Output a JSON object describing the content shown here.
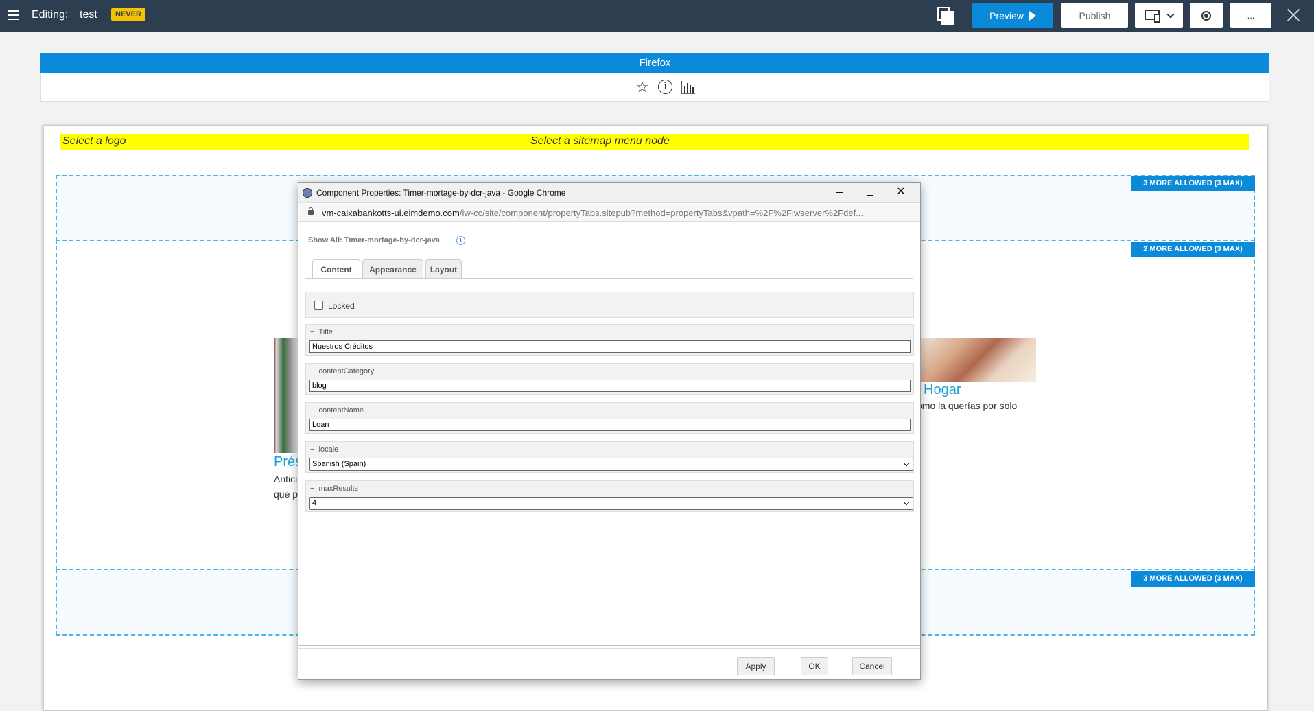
{
  "topbar": {
    "editing_label": "Editing:",
    "page_name": "test",
    "status_badge": "NEVER",
    "preview_label": "Preview",
    "publish_label": "Publish",
    "more_label": "...",
    "colors": {
      "bar": "#2c3e50",
      "accent": "#0a8ad8",
      "badge": "#f5c400"
    }
  },
  "browser": {
    "name": "Firefox",
    "icons": [
      "star-icon",
      "info-icon",
      "chart-icon"
    ]
  },
  "page": {
    "logo_placeholder": "Select a logo",
    "menu_placeholder": "Select a sitemap menu node",
    "zones": [
      {
        "badge": "3 MORE ALLOWED (3 MAX)"
      },
      {
        "badge": "2 MORE ALLOWED (3 MAX)"
      },
      {
        "badge": "3 MORE ALLOWED (3 MAX)"
      }
    ],
    "cards": {
      "left": {
        "title": "Prés",
        "line1": "Antici",
        "line2": "que p"
      },
      "right": {
        "title": "Hogar",
        "text": "omo la querías por solo"
      }
    }
  },
  "dialog": {
    "window_title": "Component Properties: Timer-mortage-by-dcr-java - Google Chrome",
    "url_host": "vm-caixabankotts-ui.eimdemo.com",
    "url_path": "/iw-cc/site/component/propertyTabs.sitepub?method=propertyTabs&vpath=%2F%2Fiwserver%2Fdef...",
    "show_all": "Show All: Timer-mortage-by-dcr-java",
    "tabs": [
      {
        "label": "Content",
        "active": true
      },
      {
        "label": "Appearance",
        "active": false
      },
      {
        "label": "Layout",
        "active": false
      }
    ],
    "locked_label": "Locked",
    "locked_checked": false,
    "fields": {
      "title": {
        "label": "Title",
        "value": "Nuestros Créditos"
      },
      "content_category": {
        "label": "contentCategory",
        "value": "blog"
      },
      "content_name": {
        "label": "contentName",
        "value": "Loan"
      },
      "locale": {
        "label": "locale",
        "value": "Spanish (Spain)"
      },
      "max_results": {
        "label": "maxResults",
        "value": "4"
      }
    },
    "buttons": {
      "apply": "Apply",
      "ok": "OK",
      "cancel": "Cancel"
    }
  }
}
